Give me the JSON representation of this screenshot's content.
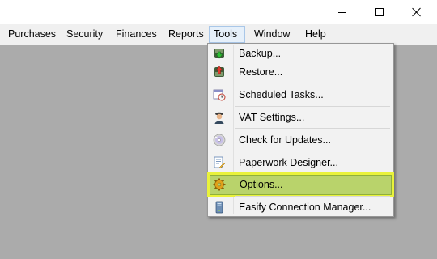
{
  "menubar": {
    "items": [
      {
        "label": "Purchases"
      },
      {
        "label": "Security"
      },
      {
        "label": "Finances"
      },
      {
        "label": "Reports"
      },
      {
        "label": "Tools"
      },
      {
        "label": "Window"
      },
      {
        "label": "Help"
      }
    ],
    "active": "Tools"
  },
  "tools_menu": {
    "items": [
      {
        "label": "Backup...",
        "icon": "backup-icon"
      },
      {
        "label": "Restore...",
        "icon": "restore-icon"
      },
      {
        "label": "Scheduled Tasks...",
        "icon": "scheduled-tasks-icon"
      },
      {
        "label": "VAT Settings...",
        "icon": "vat-settings-icon"
      },
      {
        "label": "Check for Updates...",
        "icon": "check-updates-icon"
      },
      {
        "label": "Paperwork Designer...",
        "icon": "paperwork-designer-icon"
      },
      {
        "label": "Options...",
        "icon": "options-gear-icon",
        "highlighted": true
      },
      {
        "label": "Easify Connection Manager...",
        "icon": "connection-manager-icon"
      }
    ]
  },
  "colors": {
    "background": "#ababab",
    "highlight_fill": "#b9d36b",
    "highlight_glow": "#e9f23b"
  }
}
